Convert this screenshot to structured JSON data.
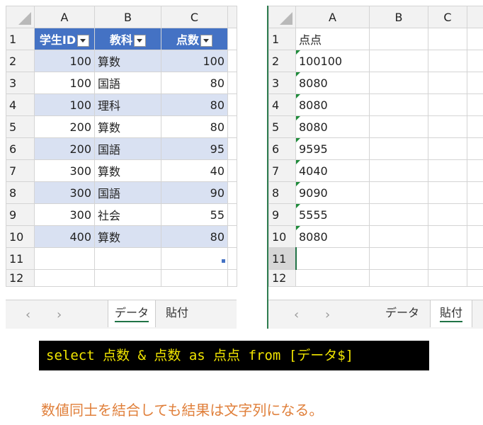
{
  "left_sheet": {
    "columns": [
      "A",
      "B",
      "C"
    ],
    "header_row_number": "1",
    "headers": [
      "学生ID",
      "教科",
      "点数"
    ],
    "rows": [
      {
        "n": "2",
        "id": "100",
        "subject": "算数",
        "score": "100"
      },
      {
        "n": "3",
        "id": "100",
        "subject": "国語",
        "score": "80"
      },
      {
        "n": "4",
        "id": "100",
        "subject": "理科",
        "score": "80"
      },
      {
        "n": "5",
        "id": "200",
        "subject": "算数",
        "score": "80"
      },
      {
        "n": "6",
        "id": "200",
        "subject": "国語",
        "score": "95"
      },
      {
        "n": "7",
        "id": "300",
        "subject": "算数",
        "score": "40"
      },
      {
        "n": "8",
        "id": "300",
        "subject": "国語",
        "score": "90"
      },
      {
        "n": "9",
        "id": "300",
        "subject": "社会",
        "score": "55"
      },
      {
        "n": "10",
        "id": "400",
        "subject": "算数",
        "score": "80"
      }
    ],
    "extra_rows": [
      "11",
      "12"
    ],
    "tabs": [
      "データ",
      "貼付"
    ],
    "active_tab": "データ"
  },
  "right_sheet": {
    "columns": [
      "A",
      "B",
      "C"
    ],
    "row_numbers": [
      "1",
      "2",
      "3",
      "4",
      "5",
      "6",
      "7",
      "8",
      "9",
      "10",
      "11",
      "12"
    ],
    "values": [
      "点点",
      "100100",
      "8080",
      "8080",
      "8080",
      "9595",
      "4040",
      "9090",
      "5555",
      "8080",
      "",
      ""
    ],
    "tabs": [
      "データ",
      "貼付"
    ],
    "active_tab": "貼付"
  },
  "sql": "select 点数 & 点数 as 点点 from [データ$]",
  "caption": "数値同士を結合しても結果は文字列になる。",
  "colors": {
    "header_blue": "#4472c4",
    "band": "#d9e1f2",
    "excel_green": "#217346",
    "caption": "#e07f3a",
    "code_text": "#f2e600"
  }
}
